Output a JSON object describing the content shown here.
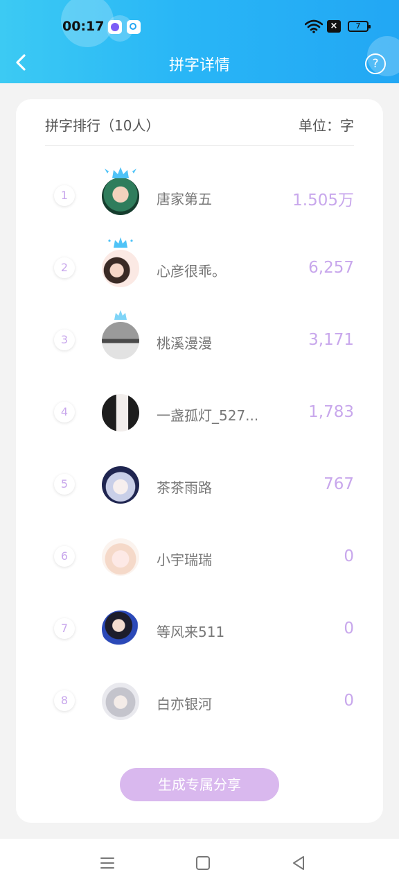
{
  "status_bar": {
    "time": "00:17",
    "battery": "7"
  },
  "header": {
    "title": "拼字详情"
  },
  "ranking": {
    "title": "拼字排行（10人）",
    "unit": "单位：字",
    "rows": [
      {
        "rank": "1",
        "name": "唐家第五",
        "score": "1.505万"
      },
      {
        "rank": "2",
        "name": "心彦很乖。",
        "score": "6,257"
      },
      {
        "rank": "3",
        "name": "桃溪漫漫",
        "score": "3,171"
      },
      {
        "rank": "4",
        "name": "一盏孤灯_527...",
        "score": "1,783"
      },
      {
        "rank": "5",
        "name": "茶茶雨路",
        "score": "767"
      },
      {
        "rank": "6",
        "name": "小宇瑞瑞",
        "score": "0"
      },
      {
        "rank": "7",
        "name": "等风来511",
        "score": "0"
      },
      {
        "rank": "8",
        "name": "白亦银河",
        "score": "0"
      }
    ]
  },
  "share_button": {
    "label": "生成专属分享"
  },
  "colors": {
    "header_start": "#3ccaf3",
    "header_end": "#22a7f4",
    "accent_purple": "#c8a7ec",
    "share_button": "#d9b8ee"
  },
  "icons": [
    "back-arrow-icon",
    "help-icon",
    "crown-icon",
    "wifi-icon",
    "battery-icon",
    "menu-icon",
    "home-square-icon",
    "back-triangle-icon"
  ]
}
